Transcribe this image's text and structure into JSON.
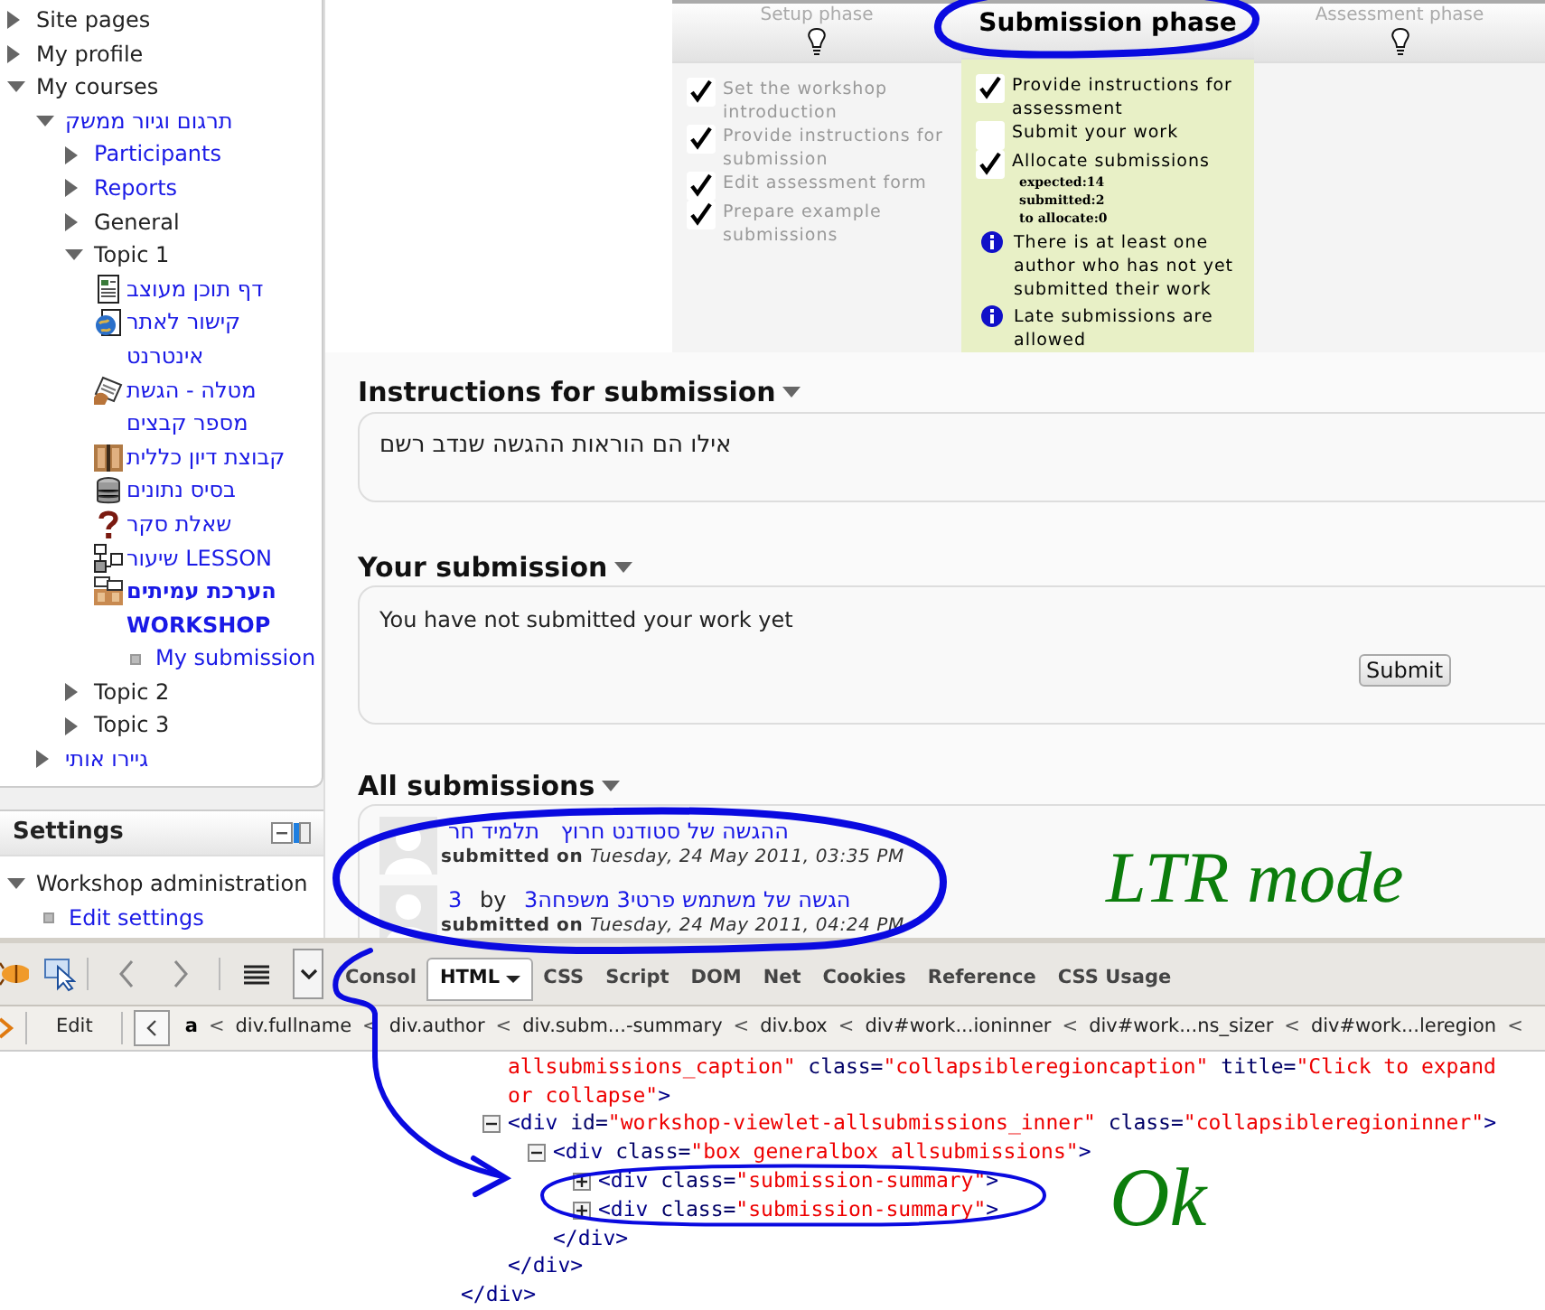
{
  "nav": {
    "items": [
      {
        "label": "Site pages",
        "kind": "branch",
        "link": false,
        "expanded": false
      },
      {
        "label": "My profile",
        "kind": "branch",
        "link": false,
        "expanded": false
      },
      {
        "label": "My courses",
        "kind": "branch",
        "link": false,
        "expanded": true,
        "children": [
          {
            "label": "תרגום וגיור ממשק",
            "kind": "branch",
            "link": true,
            "expanded": true,
            "children": [
              {
                "label": "Participants",
                "kind": "branch",
                "link": true,
                "expanded": false
              },
              {
                "label": "Reports",
                "kind": "branch",
                "link": true,
                "expanded": false
              },
              {
                "label": "General",
                "kind": "branch",
                "link": false,
                "expanded": false
              },
              {
                "label": "Topic 1",
                "kind": "branch",
                "link": false,
                "expanded": true,
                "children": [
                  {
                    "label": "דף תוכן מעוצב",
                    "kind": "page",
                    "current": false
                  },
                  {
                    "label": "קישור לאתר אינטרנט",
                    "kind": "url",
                    "current": false
                  },
                  {
                    "label": "מטלה - הגשת מספר קבצים",
                    "kind": "assignment",
                    "current": false
                  },
                  {
                    "label": "קבוצת דיון כללית",
                    "kind": "forum",
                    "current": false
                  },
                  {
                    "label": "בסיס נתונים",
                    "kind": "database",
                    "current": false
                  },
                  {
                    "label": "שאלת סקר",
                    "kind": "choice",
                    "current": false
                  },
                  {
                    "label": "שיעור LESSON",
                    "kind": "lesson",
                    "current": false
                  },
                  {
                    "label": "הערכת עמיתים WORKSHOP",
                    "kind": "workshop",
                    "current": true,
                    "children": [
                      {
                        "label": "My submission",
                        "kind": "leaf"
                      }
                    ]
                  }
                ]
              },
              {
                "label": "Topic 2",
                "kind": "branch",
                "link": false,
                "expanded": false
              },
              {
                "label": "Topic 3",
                "kind": "branch",
                "link": false,
                "expanded": false
              }
            ]
          },
          {
            "label": "גיירו אותי",
            "kind": "branch",
            "link": true,
            "expanded": false
          }
        ]
      }
    ]
  },
  "settings": {
    "title": "Settings",
    "items": [
      {
        "label": "Workshop administration",
        "kind": "branch",
        "link": false,
        "expanded": true,
        "children": [
          {
            "label": "Edit settings",
            "kind": "leaf"
          }
        ]
      }
    ]
  },
  "phases": [
    {
      "title": "Setup phase",
      "selected": false,
      "tasks": [
        {
          "label": "Set the workshop introduction",
          "done": true
        },
        {
          "label": "Provide instructions for submission",
          "done": true
        },
        {
          "label": "Edit assessment form",
          "done": true
        },
        {
          "label": "Prepare example submissions",
          "done": true
        }
      ]
    },
    {
      "title": "Submission phase",
      "selected": true,
      "tasks": [
        {
          "label": "Provide instructions for assessment",
          "done": true
        },
        {
          "label": "Submit your work",
          "done": false
        },
        {
          "label": "Allocate submissions",
          "done": true,
          "details": [
            "expected:14",
            "submitted:2",
            "to allocate:0"
          ]
        }
      ],
      "notes": [
        "There is at least one author who has not yet submitted their work",
        "Late submissions are allowed"
      ]
    },
    {
      "title": "Assessment phase",
      "selected": false
    }
  ],
  "instructions": {
    "title": "Instructions for submission",
    "text": "אילו הם הוראות ההגשה שנדב רשם"
  },
  "your_submission": {
    "title": "Your submission",
    "text": "You have not submitted your work yet",
    "button": "Submit"
  },
  "all_submissions": {
    "title": "All submissions",
    "items": [
      {
        "parts": [
          {
            "kind": "link",
            "text": "ההגשה של סטודנט חרוץ"
          },
          {
            "kind": "link",
            "text": "תלמיד חר"
          }
        ],
        "submitted_label": "submitted on",
        "date": "Tuesday, 24 May 2011, 03:35 PM"
      },
      {
        "parts": [
          {
            "kind": "link",
            "text": "3"
          },
          {
            "kind": "plain",
            "text": "by"
          },
          {
            "kind": "link",
            "text": "הגשה של משתמש פרטי3 משפחה3"
          }
        ],
        "submitted_label": "submitted on",
        "date": "Tuesday, 24 May 2011, 04:24 PM"
      }
    ]
  },
  "devtools": {
    "tabs": [
      {
        "label": "Consol",
        "selected": false,
        "menu": false
      },
      {
        "label": "HTML",
        "selected": true,
        "menu": true
      },
      {
        "label": "CSS",
        "selected": false,
        "menu": false
      },
      {
        "label": "Script",
        "selected": false,
        "menu": false
      },
      {
        "label": "DOM",
        "selected": false,
        "menu": false
      },
      {
        "label": "Net",
        "selected": false,
        "menu": false
      },
      {
        "label": "Cookies",
        "selected": false,
        "menu": false
      },
      {
        "label": "Reference",
        "selected": false,
        "menu": false
      },
      {
        "label": "CSS Usage",
        "selected": false,
        "menu": false
      }
    ],
    "edit_button": "Edit",
    "breadcrumbs": [
      {
        "label": "a",
        "selected": true,
        "separator": "<"
      },
      {
        "label": "div.fullname",
        "selected": false,
        "separator": "<"
      },
      {
        "label": "div.author",
        "selected": false,
        "separator": "<"
      },
      {
        "label": "div.subm...-summary",
        "selected": false,
        "separator": "<"
      },
      {
        "label": "div.box",
        "selected": false,
        "separator": "<"
      },
      {
        "label": "div#work...ioninner",
        "selected": false,
        "separator": "<"
      },
      {
        "label": "div#work...ns_sizer",
        "selected": false,
        "separator": "<"
      },
      {
        "label": "div#work...leregion",
        "selected": false,
        "separator": "<"
      }
    ],
    "code_view": {
      "children": [
        {
          "kind": "continuation",
          "tokens": [
            {
              "kind": "value",
              "text": "allsubmissions_caption\""
            },
            {
              "kind": "attr",
              "text": " class="
            },
            {
              "kind": "value",
              "text": "\"collapsibleregioncaption\""
            },
            {
              "kind": "attr",
              "text": " title="
            },
            {
              "kind": "value",
              "text": "\"Click to expand or collapse\""
            },
            {
              "kind": "tag",
              "text": ">"
            }
          ]
        },
        {
          "kind": "element",
          "expanded": true,
          "tokens": [
            {
              "kind": "tag",
              "text": "<div"
            },
            {
              "kind": "attr",
              "text": " id="
            },
            {
              "kind": "value",
              "text": "\"workshop-viewlet-allsubmissions_inner\""
            },
            {
              "kind": "attr",
              "text": " class="
            },
            {
              "kind": "value",
              "text": "\"collapsibleregioninner\""
            },
            {
              "kind": "tag",
              "text": ">"
            }
          ],
          "children": [
            {
              "kind": "element",
              "expanded": true,
              "tokens": [
                {
                  "kind": "tag",
                  "text": "<div"
                },
                {
                  "kind": "attr",
                  "text": " class="
                },
                {
                  "kind": "value",
                  "text": "\"box generalbox allsubmissions\""
                },
                {
                  "kind": "tag",
                  "text": ">"
                }
              ],
              "children": [
                {
                  "kind": "element",
                  "expanded": false,
                  "tokens": [
                    {
                      "kind": "tag",
                      "text": "<div"
                    },
                    {
                      "kind": "attr",
                      "text": " class="
                    },
                    {
                      "kind": "value",
                      "text": "\"submission-summary\""
                    },
                    {
                      "kind": "tag",
                      "text": ">"
                    }
                  ]
                },
                {
                  "kind": "element",
                  "expanded": false,
                  "tokens": [
                    {
                      "kind": "tag",
                      "text": "<div"
                    },
                    {
                      "kind": "attr",
                      "text": " class="
                    },
                    {
                      "kind": "value",
                      "text": "\"submission-summary\""
                    },
                    {
                      "kind": "tag",
                      "text": ">"
                    }
                  ]
                }
              ],
              "closing": "</div>"
            }
          ],
          "closing": "</div>"
        }
      ],
      "closing": "</div>"
    }
  },
  "ink_notes": [
    {
      "text": "LTR mode"
    },
    {
      "text": "Ok"
    }
  ]
}
